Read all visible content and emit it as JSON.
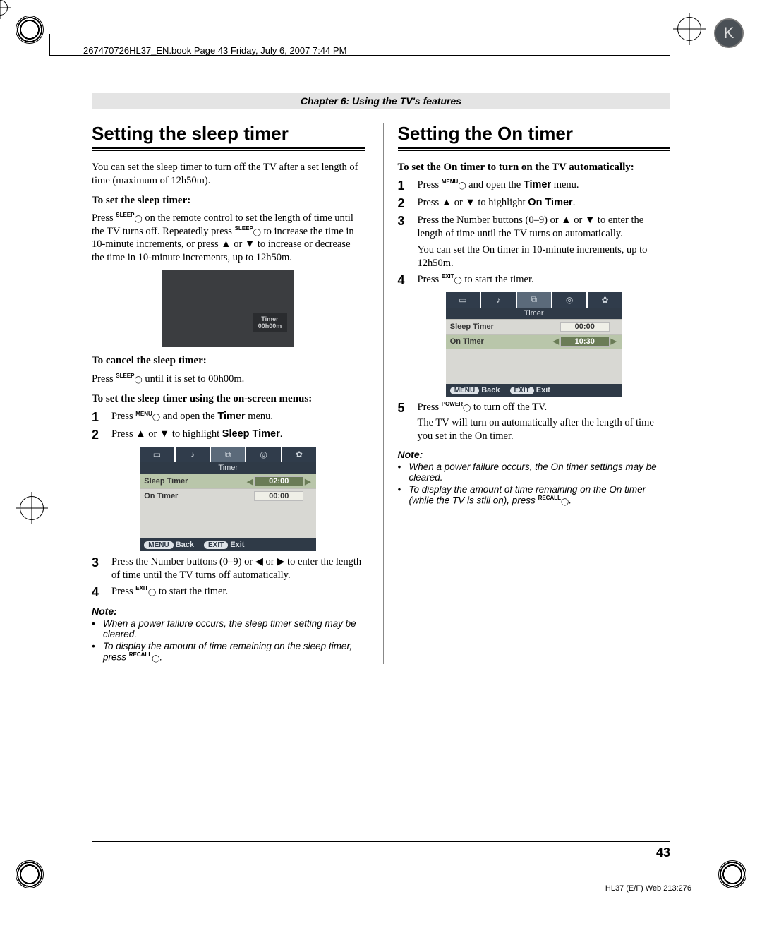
{
  "meta": {
    "frame_text": "267470726HL37_EN.book  Page 43  Friday, July 6, 2007  7:44 PM",
    "ink_badge": "K"
  },
  "chapter": "Chapter 6: Using the TV's features",
  "left": {
    "heading": "Setting the sleep timer",
    "intro": "You can set the sleep timer to turn off the TV after a set length of time (maximum of 12h50m).",
    "sub1": "To set the sleep timer:",
    "sub1_body_a": "Press ",
    "sub1_btn1": "SLEEP",
    "sub1_body_b": " on the remote control to set the length of time until the TV turns off. Repeatedly press ",
    "sub1_btn2": "SLEEP",
    "sub1_body_c": " to increase the time in 10-minute increments, or press ▲ or ▼ to increase or decrease the time in 10-minute increments, up to 12h50m.",
    "timerbox_label_line1": "Timer",
    "timerbox_label_line2": "00h00m",
    "sub2": "To cancel the sleep timer:",
    "sub2_body_a": "Press ",
    "sub2_btn": "SLEEP",
    "sub2_body_b": " until it is set to 00h00m.",
    "sub3": "To set the sleep timer using the on-screen menus:",
    "step1_a": "Press ",
    "step1_btn": "MENU",
    "step1_b": " and open the ",
    "step1_bold": "Timer",
    "step1_c": " menu.",
    "step2_a": "Press ▲ or ▼ to highlight ",
    "step2_bold": "Sleep Timer",
    "step2_b": ".",
    "osd": {
      "title": "Timer",
      "row1_label": "Sleep Timer",
      "row1_val": "02:00",
      "row2_label": "On Timer",
      "row2_val": "00:00",
      "foot_back_pill": "MENU",
      "foot_back": "Back",
      "foot_exit_pill": "EXIT",
      "foot_exit": "Exit"
    },
    "step3": "Press the Number buttons (0–9) or ◀ or ▶ to enter the length of time until the TV turns off automatically.",
    "step4_a": "Press ",
    "step4_btn": "EXIT",
    "step4_b": " to start the timer.",
    "note_head": "Note:",
    "note1": "When a power failure occurs, the sleep timer setting may be cleared.",
    "note2_a": "To display the amount of time remaining on the sleep timer, press ",
    "note2_btn": "RECALL",
    "note2_b": "."
  },
  "right": {
    "heading": "Setting the On timer",
    "sub1": "To set the On timer to turn on the TV automatically:",
    "step1_a": "Press ",
    "step1_btn": "MENU",
    "step1_b": " and open the ",
    "step1_bold": "Timer",
    "step1_c": " menu.",
    "step2_a": "Press ▲ or ▼ to highlight ",
    "step2_bold": "On Timer",
    "step2_b": ".",
    "step3_a": "Press the Number buttons (0–9) or ▲ or ▼ to enter the length of time until the TV turns on automatically.",
    "step3_b": "You can set the On timer in 10-minute increments, up to 12h50m.",
    "step4_a": "Press ",
    "step4_btn": "EXIT",
    "step4_b": " to start the timer.",
    "osd": {
      "title": "Timer",
      "row1_label": "Sleep Timer",
      "row1_val": "00:00",
      "row2_label": "On Timer",
      "row2_val": "10:30",
      "foot_back_pill": "MENU",
      "foot_back": "Back",
      "foot_exit_pill": "EXIT",
      "foot_exit": "Exit"
    },
    "step5_a": "Press ",
    "step5_btn": "POWER",
    "step5_b": " to turn off the TV.",
    "step5_c": "The TV will turn on automatically after the length of time you set in the On timer.",
    "note_head": "Note:",
    "note1": "When a power failure occurs, the On timer settings may be cleared.",
    "note2_a": "To display the amount of time remaining on the On timer (while the TV is still on), press ",
    "note2_btn": "RECALL",
    "note2_b": "."
  },
  "footer": {
    "page_num": "43",
    "code": "HL37 (E/F) Web 213:276"
  }
}
